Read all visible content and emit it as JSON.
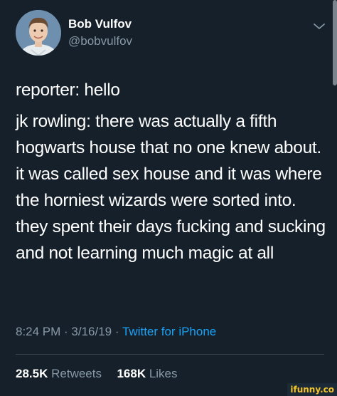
{
  "user": {
    "display_name": "Bob Vulfov",
    "handle": "@bobvulfov",
    "avatar": "person-photo"
  },
  "tweet": {
    "line1": "reporter: hello",
    "line2": "jk rowling: there was actually a fifth hogwarts house that no one knew about. it was called sex house and it was where the horniest wizards were sorted into. they spent their days fucking and sucking and not learning much magic at all"
  },
  "meta": {
    "time": "8:24 PM",
    "separator": " · ",
    "date": "3/16/19",
    "source": "Twitter for iPhone"
  },
  "stats": {
    "retweets_count": "28.5K",
    "retweets_label": "Retweets",
    "likes_count": "168K",
    "likes_label": "Likes"
  },
  "icons": {
    "caret": "chevron-down-icon"
  },
  "colors": {
    "background": "#15202b",
    "text_primary": "#ffffff",
    "text_secondary": "#8899a6",
    "link": "#1da1f2",
    "divider": "#38444d"
  },
  "watermark": "ifunny.co"
}
